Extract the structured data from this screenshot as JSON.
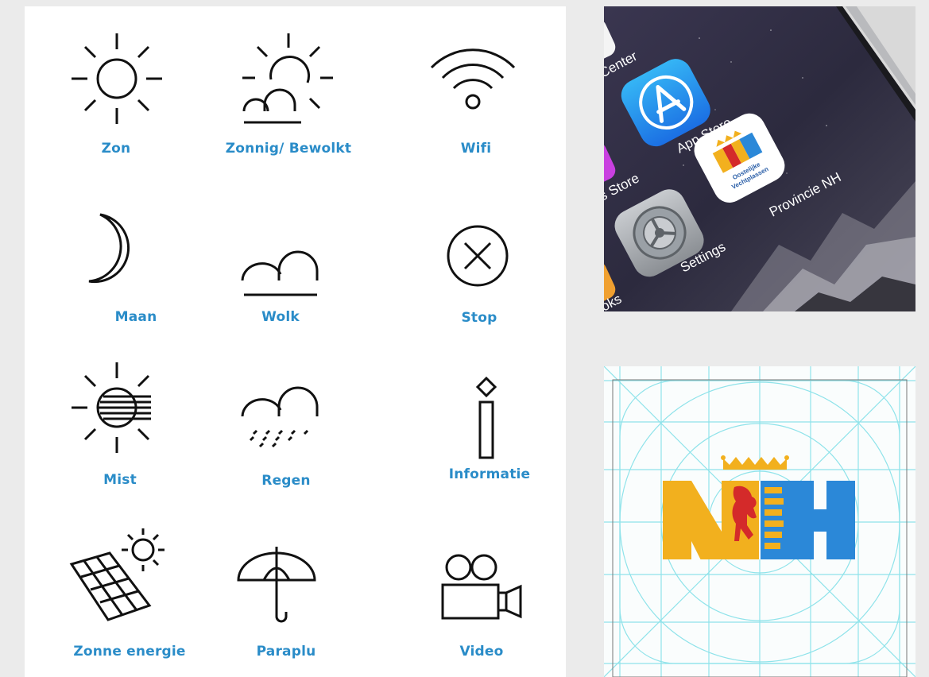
{
  "icon_set": {
    "items": [
      {
        "icon": "sun-icon",
        "label": "Zon"
      },
      {
        "icon": "partly-cloudy-icon",
        "label": "Zonnig/ Bewolkt"
      },
      {
        "icon": "wifi-icon",
        "label": "Wifi"
      },
      {
        "icon": "moon-icon",
        "label": "Maan"
      },
      {
        "icon": "cloud-icon",
        "label": "Wolk"
      },
      {
        "icon": "stop-icon",
        "label": "Stop"
      },
      {
        "icon": "fog-icon",
        "label": "Mist"
      },
      {
        "icon": "rain-icon",
        "label": "Regen"
      },
      {
        "icon": "info-icon",
        "label": "Informatie"
      },
      {
        "icon": "solar-panel-icon",
        "label": "Zonne energie"
      },
      {
        "icon": "umbrella-icon",
        "label": "Paraplu"
      },
      {
        "icon": "video-camera-icon",
        "label": "Video"
      }
    ]
  },
  "phone_screen": {
    "apps": [
      {
        "icon": "control-center-icon",
        "label": "Center"
      },
      {
        "icon": "app-store-icon",
        "label": "App Store"
      },
      {
        "icon": "music-store-icon",
        "label": "s Store"
      },
      {
        "icon": "provincie-nh-app-icon",
        "label": "Provincie NH",
        "icon_text": "Oostelijke Vechtplassen"
      },
      {
        "icon": "settings-icon",
        "label": "Settings"
      },
      {
        "icon": "books-icon",
        "label": "oks"
      }
    ]
  },
  "app_icon_grid": {
    "logo": "NH"
  },
  "colors": {
    "label": "#2a8cc8",
    "nh_yellow": "#f2b01e",
    "nh_blue": "#2b88d8",
    "lion_red": "#d42a2a",
    "grid_line": "#8fe3ea"
  }
}
